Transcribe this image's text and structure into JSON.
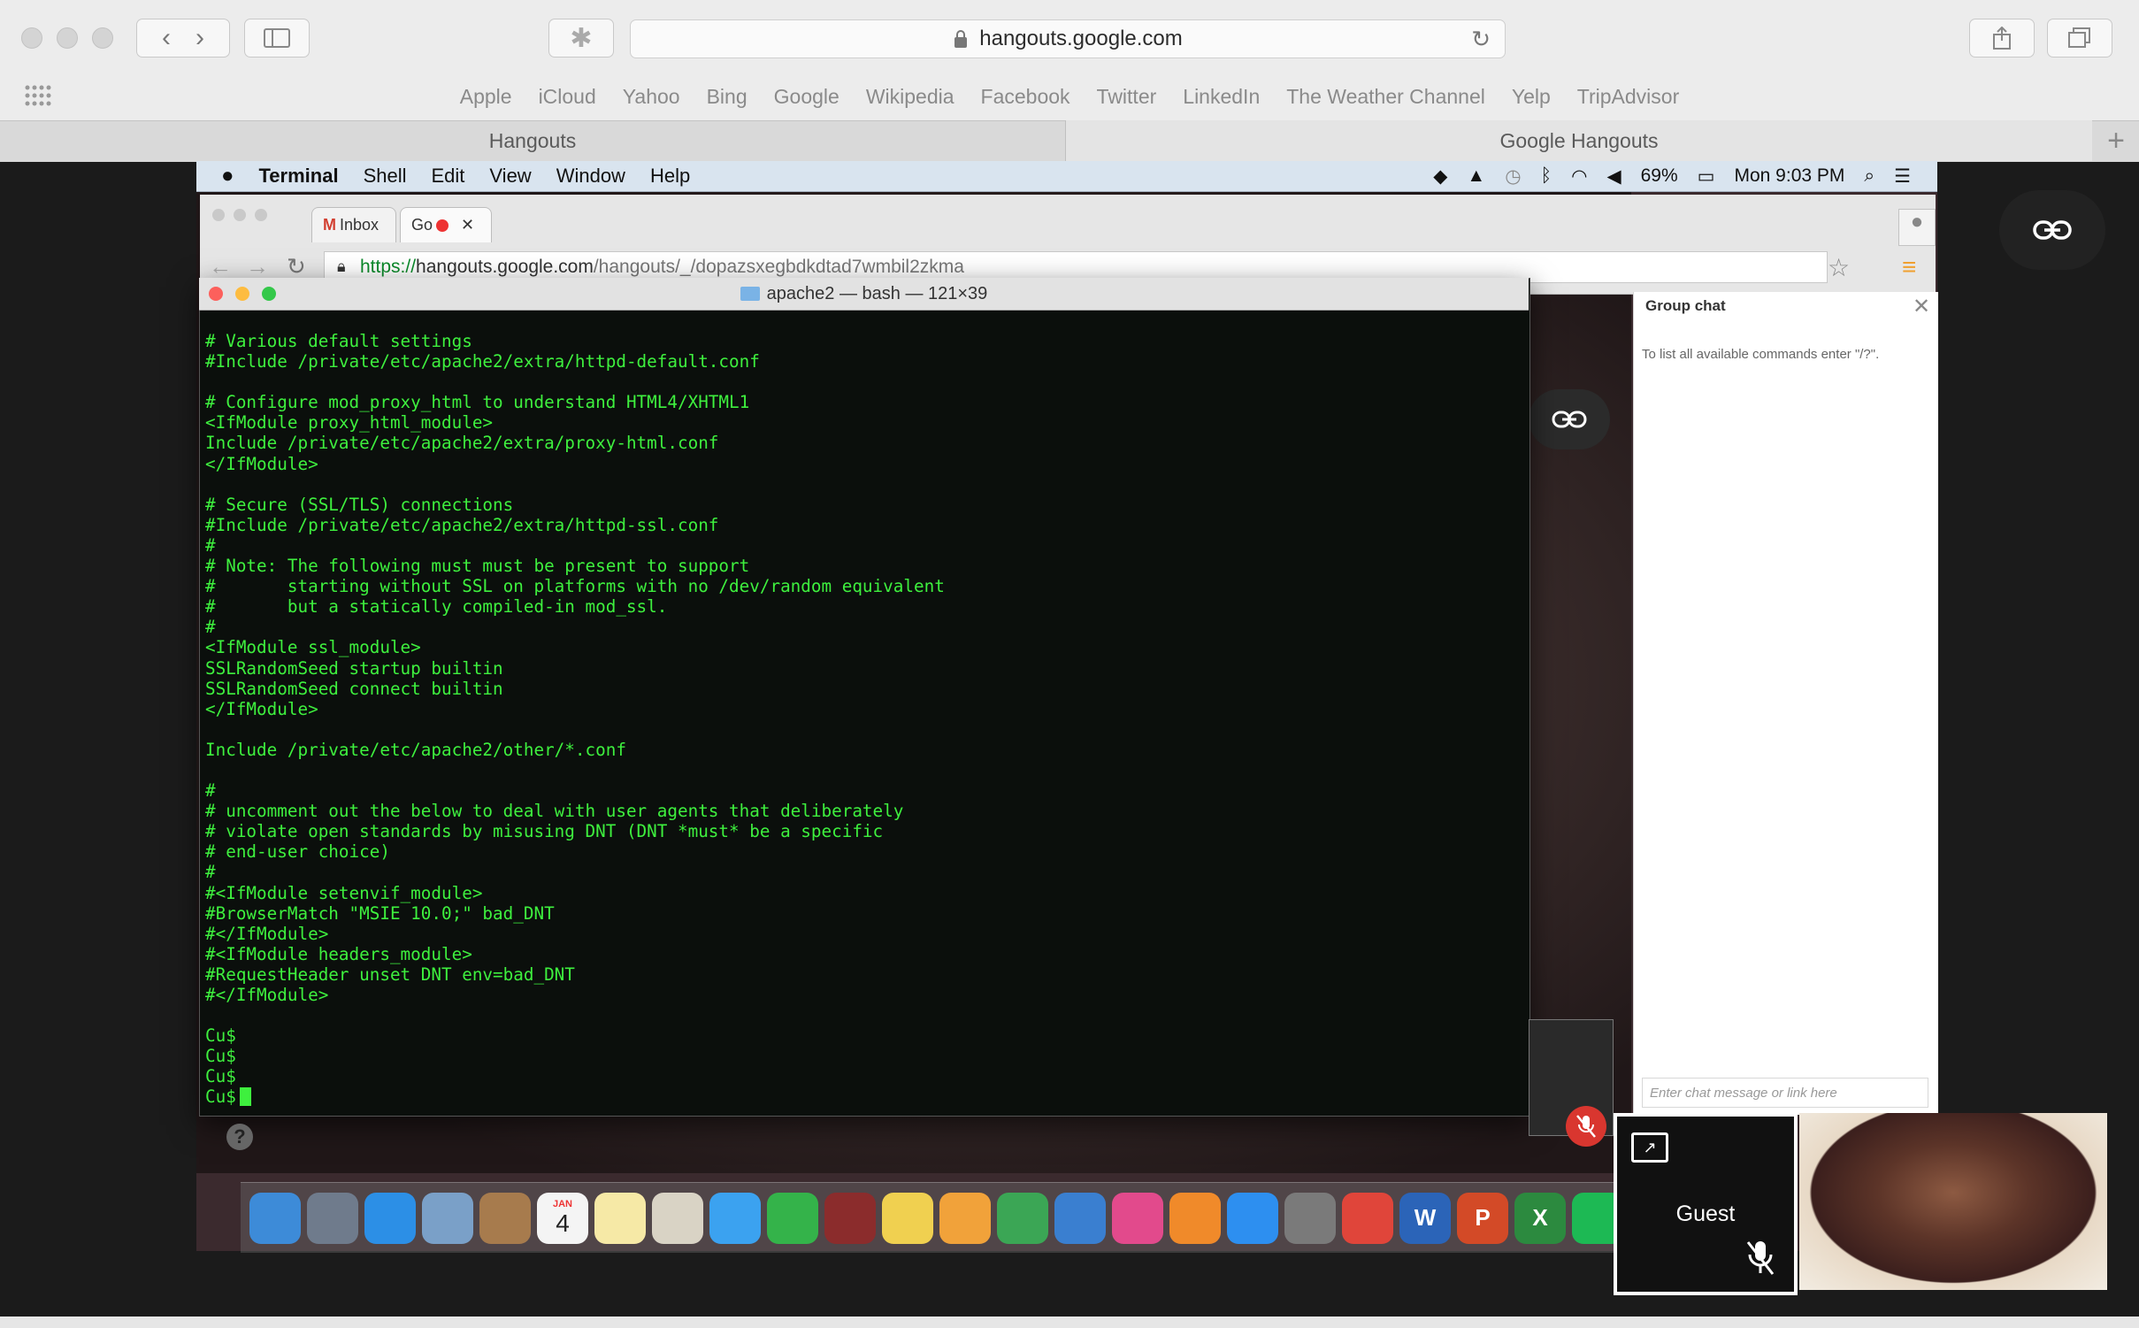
{
  "safari": {
    "address": "hangouts.google.com",
    "favorites": [
      "Apple",
      "iCloud",
      "Yahoo",
      "Bing",
      "Google",
      "Wikipedia",
      "Facebook",
      "Twitter",
      "LinkedIn",
      "The Weather Channel",
      "Yelp",
      "TripAdvisor"
    ],
    "tabs": [
      "Hangouts",
      "Google Hangouts"
    ]
  },
  "mac_menubar": {
    "app": "Terminal",
    "items": [
      "Shell",
      "Edit",
      "View",
      "Window",
      "Help"
    ],
    "battery": "69%",
    "clock": "Mon 9:03 PM"
  },
  "chrome": {
    "tab1": "Inbox",
    "tab2": "Go",
    "url_scheme": "https://",
    "url_host": "hangouts.google.com",
    "url_path": "/hangouts/_/dopazsxegbdkdtad7wmbil2zkma"
  },
  "terminal": {
    "title": "apache2 — bash — 121×39",
    "body": "# Various default settings\n#Include /private/etc/apache2/extra/httpd-default.conf\n\n# Configure mod_proxy_html to understand HTML4/XHTML1\n<IfModule proxy_html_module>\nInclude /private/etc/apache2/extra/proxy-html.conf\n</IfModule>\n\n# Secure (SSL/TLS) connections\n#Include /private/etc/apache2/extra/httpd-ssl.conf\n#\n# Note: The following must must be present to support\n#       starting without SSL on platforms with no /dev/random equivalent\n#       but a statically compiled-in mod_ssl.\n#\n<IfModule ssl_module>\nSSLRandomSeed startup builtin\nSSLRandomSeed connect builtin\n</IfModule>\n\nInclude /private/etc/apache2/other/*.conf\n\n#\n# uncomment out the below to deal with user agents that deliberately\n# violate open standards by misusing DNT (DNT *must* be a specific\n# end-user choice)\n#\n#<IfModule setenvif_module>\n#BrowserMatch \"MSIE 10.0;\" bad_DNT\n#</IfModule>\n#<IfModule headers_module>\n#RequestHeader unset DNT env=bad_DNT\n#</IfModule>\n\nCu$\nCu$\nCu$\nCu$"
  },
  "group_chat": {
    "title": "Group chat",
    "hint": "To list all available commands enter \"/?\".",
    "input_placeholder": "Enter chat message or link here"
  },
  "participants": {
    "guest": "Guest"
  },
  "dock": {
    "calendar_day": "4",
    "calendar_month": "JAN",
    "apps": [
      {
        "name": "finder-icon",
        "color": "#3d8bd8",
        "glyph": ""
      },
      {
        "name": "launchpad-icon",
        "color": "#6f7b8c",
        "glyph": ""
      },
      {
        "name": "safari-icon",
        "color": "#2c8fe6",
        "glyph": ""
      },
      {
        "name": "mail-icon",
        "color": "#7aa0c8",
        "glyph": ""
      },
      {
        "name": "contacts-icon",
        "color": "#a77b4d",
        "glyph": ""
      },
      {
        "name": "calendar-icon",
        "color": "#f4f4f4",
        "glyph": ""
      },
      {
        "name": "notes-icon",
        "color": "#f6e9a6",
        "glyph": ""
      },
      {
        "name": "preview-icon",
        "color": "#d9d3c5",
        "glyph": ""
      },
      {
        "name": "messages-icon",
        "color": "#3ba2f0",
        "glyph": ""
      },
      {
        "name": "facetime-icon",
        "color": "#34b34a",
        "glyph": ""
      },
      {
        "name": "photo-booth-icon",
        "color": "#8b2c2c",
        "glyph": ""
      },
      {
        "name": "photos-icon",
        "color": "#f0d050",
        "glyph": ""
      },
      {
        "name": "pages-icon",
        "color": "#f1a23a",
        "glyph": ""
      },
      {
        "name": "numbers-icon",
        "color": "#3ba655",
        "glyph": ""
      },
      {
        "name": "keynote-icon",
        "color": "#3a7fd0",
        "glyph": ""
      },
      {
        "name": "itunes-icon",
        "color": "#e24a8c",
        "glyph": ""
      },
      {
        "name": "ibooks-icon",
        "color": "#f08a2a",
        "glyph": ""
      },
      {
        "name": "app-store-icon",
        "color": "#2d8ff0",
        "glyph": ""
      },
      {
        "name": "system-preferences-icon",
        "color": "#7a7a7a",
        "glyph": ""
      },
      {
        "name": "chrome-icon",
        "color": "#e0453a",
        "glyph": ""
      },
      {
        "name": "word-icon",
        "color": "#2b64b8",
        "glyph": "W"
      },
      {
        "name": "powerpoint-icon",
        "color": "#d34a27",
        "glyph": "P"
      },
      {
        "name": "excel-icon",
        "color": "#2c8a3f",
        "glyph": "X"
      },
      {
        "name": "spotify-icon",
        "color": "#1db954",
        "glyph": ""
      }
    ]
  },
  "colors": {
    "terminal_text": "#3ef03e",
    "url_secure": "#0a8a2a",
    "mute_red": "#d9362f"
  }
}
